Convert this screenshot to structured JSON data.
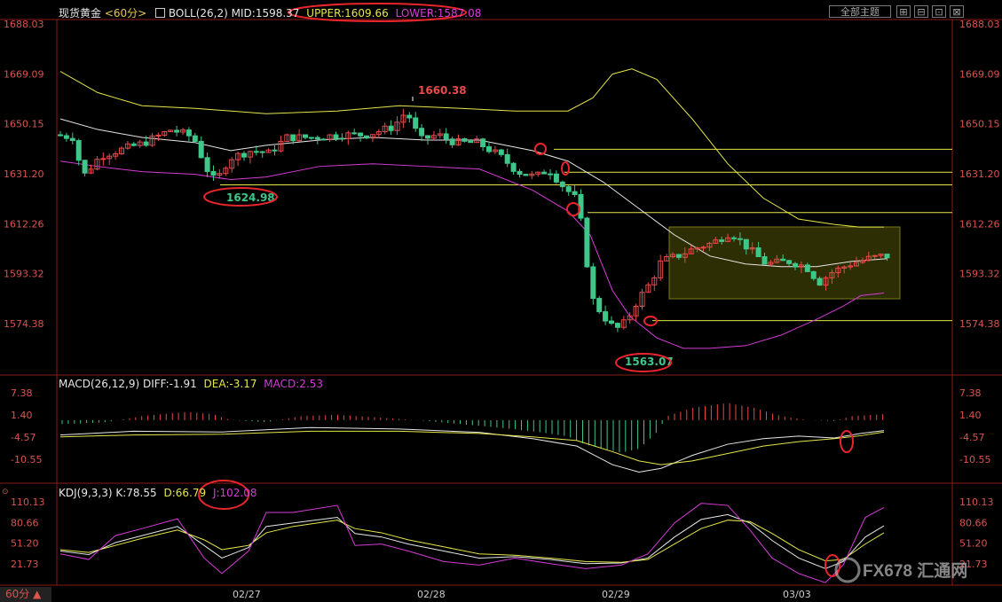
{
  "header": {
    "symbol": "现货黄金",
    "period": "<60分>",
    "boll_label": "BOLL(26,2)",
    "mid": "MID:1598.37",
    "upper": "UPPER:1609.66",
    "lower": "LOWER:1587.08",
    "theme_button": "全部主题",
    "window_buttons": [
      "⊞",
      "⊟",
      "⊡",
      "⊠"
    ]
  },
  "macd_header": {
    "label": "MACD(26,12,9)",
    "diff": "DIFF:-1.91",
    "dea": "DEA:-3.17",
    "macd": "MACD:2.53"
  },
  "kdj_header": {
    "label": "KDJ(9,3,3)",
    "k": "K:78.55",
    "d": "D:66.79",
    "j": "J:102.08"
  },
  "footer": {
    "period": "60分 ▲",
    "watermark": "FX678 汇通网"
  },
  "annotations": {
    "high": "1660.38",
    "low1": "1624.98",
    "low2": "1563.07"
  },
  "colors": {
    "up": "#e84a4a",
    "down": "#3fc78a",
    "mid": "#e6e6e6",
    "upper": "#e6e64a",
    "lower": "#d63bd6",
    "dea": "#e6e64a",
    "axis": "#d9534f",
    "ellipse": "#e8252b",
    "box": "#7a7a1a"
  },
  "chart_data": [
    {
      "type": "candlestick",
      "title": "现货黄金 60分",
      "price_ticks": [
        "1688.03",
        "1669.09",
        "1650.15",
        "1631.20",
        "1612.26",
        "1593.32",
        "1574.38"
      ],
      "x_labels": [
        "02/27",
        "02/28",
        "02/29",
        "03/03"
      ],
      "series": [
        {
          "name": "MID",
          "value": 1598.37
        },
        {
          "name": "UPPER",
          "value": 1609.66
        },
        {
          "name": "LOWER",
          "value": 1587.08
        }
      ],
      "levels": [
        1640.5,
        1631.8,
        1627.0,
        1616.5,
        1575.5
      ],
      "annotations": [
        {
          "label": "1660.38",
          "value": 1660.38
        },
        {
          "label": "1624.98",
          "value": 1624.98
        },
        {
          "label": "1563.07",
          "value": 1563.07
        }
      ]
    },
    {
      "type": "bar",
      "title": "MACD(26,12,9)",
      "y_ticks": [
        "7.38",
        "1.40",
        "-4.57",
        "-10.55"
      ],
      "series": [
        {
          "name": "DIFF",
          "value": -1.91
        },
        {
          "name": "DEA",
          "value": -3.17
        },
        {
          "name": "MACD",
          "value": 2.53
        }
      ]
    },
    {
      "type": "line",
      "title": "KDJ(9,3,3)",
      "y_ticks": [
        "110.13",
        "80.66",
        "51.20",
        "21.73"
      ],
      "series": [
        {
          "name": "K",
          "value": 78.55
        },
        {
          "name": "D",
          "value": 66.79
        },
        {
          "name": "J",
          "value": 102.08
        }
      ]
    }
  ]
}
